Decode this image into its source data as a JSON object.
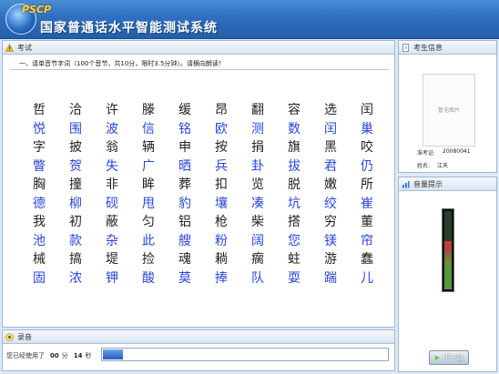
{
  "app": {
    "logo_text": "PSCP",
    "title": "国家普通话水平智能测试系统"
  },
  "exam": {
    "section_title": "考试",
    "instruction": "一、请单音节字词（100个音节，共10分，限时3.5分钟）。请横向朗读！",
    "rows": [
      {
        "color": "black",
        "chars": [
          "哲",
          "洽",
          "许",
          "滕",
          "缓",
          "昂",
          "翻",
          "容",
          "选",
          "闰"
        ]
      },
      {
        "color": "blue",
        "chars": [
          "悦",
          "围",
          "波",
          "信",
          "铭",
          "欧",
          "测",
          "数",
          "闰",
          "巢"
        ]
      },
      {
        "color": "black",
        "chars": [
          "字",
          "披",
          "翁",
          "辆",
          "申",
          "按",
          "捐",
          "旗",
          "黑",
          "咬"
        ]
      },
      {
        "color": "blue",
        "chars": [
          "瞥",
          "贺",
          "失",
          "广",
          "晒",
          "兵",
          "卦",
          "拔",
          "君",
          "仍"
        ]
      },
      {
        "color": "black",
        "chars": [
          "胸",
          "撞",
          "非",
          "眸",
          "葬",
          "扣",
          "览",
          "脱",
          "嫩",
          "所"
        ]
      },
      {
        "color": "blue",
        "chars": [
          "德",
          "柳",
          "砚",
          "甩",
          "豹",
          "壤",
          "凑",
          "坑",
          "绞",
          "崔"
        ]
      },
      {
        "color": "black",
        "chars": [
          "我",
          "初",
          "蔽",
          "匀",
          "铝",
          "枪",
          "柴",
          "搭",
          "穷",
          "董"
        ]
      },
      {
        "color": "blue",
        "chars": [
          "池",
          "款",
          "杂",
          "此",
          "艘",
          "粉",
          "阔",
          "您",
          "镁",
          "帘"
        ]
      },
      {
        "color": "black",
        "chars": [
          "械",
          "搞",
          "堤",
          "捡",
          "魂",
          "耥",
          "瘸",
          "蛀",
          "游",
          "蠢"
        ]
      },
      {
        "color": "blue",
        "chars": [
          "固",
          "浓",
          "钾",
          "酸",
          "莫",
          "捧",
          "队",
          "耍",
          "踹",
          "儿"
        ]
      }
    ]
  },
  "recording": {
    "section_title": "录音",
    "elapsed_label": "您已经使用了",
    "minutes": "00",
    "minutes_unit": "分",
    "seconds": "14",
    "seconds_unit": "秒",
    "progress_fraction": 0.07
  },
  "examinee": {
    "section_title": "考生信息",
    "photo_placeholder": "暂无图片",
    "id_label": "准考证:",
    "id_value": "20080041",
    "name_label": "姓名:",
    "name_value": "江天"
  },
  "volume": {
    "section_title": "音量提示",
    "level_fraction": 0.6
  },
  "actions": {
    "next_label": "下一题"
  },
  "colors": {
    "header": "#2f6fc0",
    "char_black": "#222222",
    "char_blue": "#2a45d8"
  }
}
